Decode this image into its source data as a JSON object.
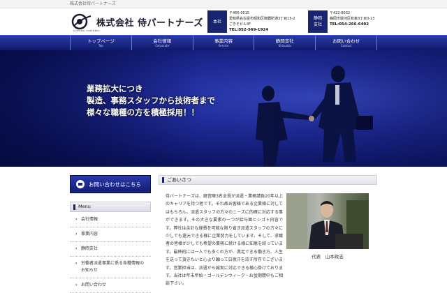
{
  "topbar": {
    "text": "株式会社侍パートナーズ"
  },
  "header": {
    "company_name": "株式会社 侍パートナーズ",
    "logo_sub": "SAMURAI PARTNERS",
    "offices": [
      {
        "badge": "本社",
        "zip": "〒466-0015",
        "address1": "愛知県名古屋市昭和区御器所通3丁目15-2",
        "address2": "ごきそビル4F",
        "tel": "TEL:052-569-1924"
      },
      {
        "badge": "静岡\n支社",
        "zip": "〒422-8032",
        "address1": "静岡市駿河区有東3丁目3-23",
        "tel": "TEL:054-266-6492"
      }
    ]
  },
  "nav": [
    {
      "jp": "トップページ",
      "en": "Top"
    },
    {
      "jp": "会社情報",
      "en": "Corporate"
    },
    {
      "jp": "事業内容",
      "en": "Service"
    },
    {
      "jp": "静岡支社",
      "en": "Shizuoka"
    },
    {
      "jp": "お問い合わせ",
      "en": "Contact"
    }
  ],
  "hero": {
    "line1": "業務拡大につき",
    "line2": "製造、事務スタッフから技術者まで",
    "line3": "様々な職種の方を積極採用！！"
  },
  "sidebar": {
    "contact_button": "お問い合わせはこちら",
    "menu_title": "Menu",
    "items": [
      {
        "label": "会社情報"
      },
      {
        "label": "事業内容"
      },
      {
        "label": "静岡支社"
      },
      {
        "label": "労働者派遣事業に係る各種情報のお知らせ"
      },
      {
        "label": "お問い合わせ"
      }
    ]
  },
  "main": {
    "section_title": "ごあいさつ",
    "greeting": "侍パートナーズは、経営陣3名全員が派遣・業務請負20年以上のキャリアを持つ者です。それ故お客様である企業様に対してはもちろん、派遣スタッフの方々のニーズに的確に対応する事ができます。その大きな要素の一つが給与面とシゴト内容です。弊社は余計な経費を可能な限り省き派遣スタッフの方々に少しでも還元できる様に企業努力をしています。そして、求職者の皆様が少しでも希望の業務に就ける様に知恵を絞っています。最終的には一人でも多くの方が、満足できる働き方、人生を送って頂きたいと心より願って日夜汗を流す所存でございます。営業担当は、派遣から誠実に対応できる様心掛けております。当社は年末年始・ゴールデンウィーク・お盆期間中もご相談下さい。",
    "photo_caption": "代表　山本政志"
  }
}
